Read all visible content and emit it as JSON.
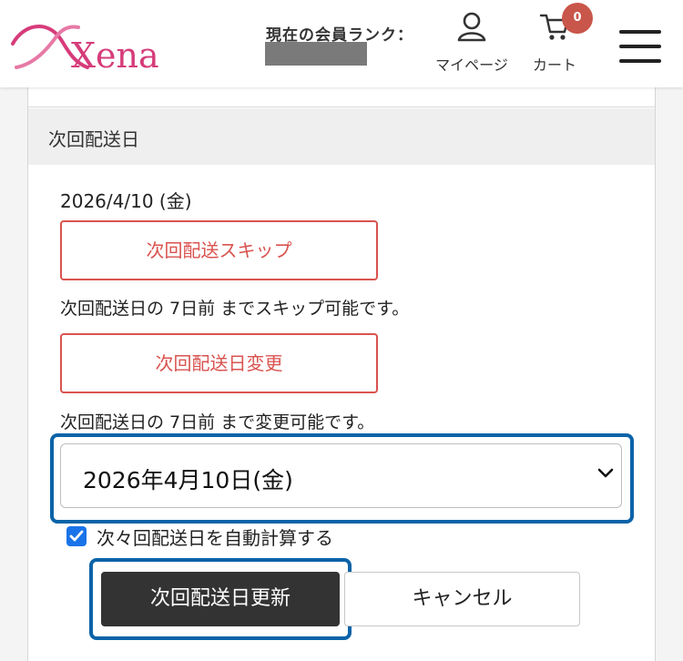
{
  "header": {
    "logo_text": "Xena",
    "rank_label": "現在の会員ランク：",
    "mypage_label": "マイページ",
    "cart_label": "カート",
    "cart_count": "0"
  },
  "section": {
    "title": "次回配送日",
    "current_date": "2026/4/10 (金)",
    "skip_button": "次回配送スキップ",
    "skip_note": "次回配送日の 7日前 までスキップ可能です。",
    "change_button": "次回配送日変更",
    "change_note": "次回配送日の 7日前 まで変更可能です。",
    "date_select_value": "2026年4月10日(金)",
    "auto_calc_checked": true,
    "auto_calc_label": "次々回配送日を自動計算する",
    "update_button": "次回配送日更新",
    "cancel_button": "キャンセル"
  },
  "colors": {
    "accent_red": "#d9534f",
    "focus_blue": "#0a63a8",
    "logo_pink": "#d63c7a",
    "badge": "#c9564a"
  },
  "icons": [
    "user-icon",
    "cart-icon",
    "menu-icon",
    "chevron-down-icon",
    "checkmark-icon"
  ]
}
